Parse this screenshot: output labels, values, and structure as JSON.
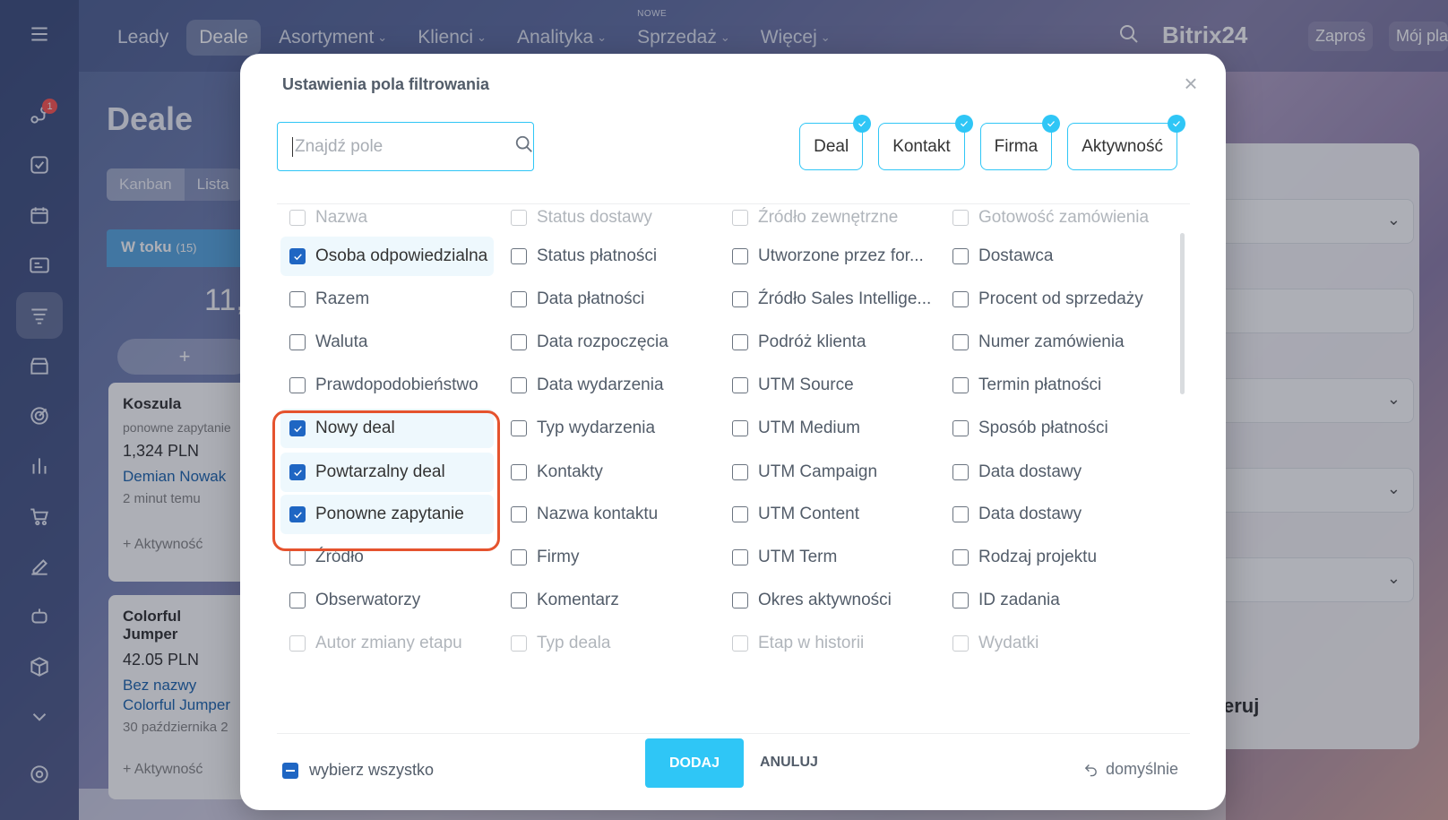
{
  "app": {
    "brand": "Bitrix24",
    "nav": [
      {
        "label": "Leady",
        "active": false,
        "chevron": false,
        "note": ""
      },
      {
        "label": "Deale",
        "active": true,
        "chevron": false,
        "note": ""
      },
      {
        "label": "Asortyment",
        "active": false,
        "chevron": true,
        "note": ""
      },
      {
        "label": "Klienci",
        "active": false,
        "chevron": true,
        "note": ""
      },
      {
        "label": "Analityka",
        "active": false,
        "chevron": true,
        "note": ""
      },
      {
        "label": "Sprzedaż",
        "active": false,
        "chevron": true,
        "note": "NOWE"
      },
      {
        "label": "Więcej",
        "active": false,
        "chevron": true,
        "note": ""
      }
    ],
    "invite_label": "Zaproś",
    "my_plan_label": "Mój pla",
    "rail_badge": "1",
    "page_title": "Deale",
    "views": [
      "Kanban",
      "Lista"
    ],
    "column": {
      "title": "W toku",
      "count": "(15)",
      "sum": "11,"
    },
    "cards": [
      {
        "title": "Koszula",
        "subtitle": "ponowne zapytanie",
        "price": "1,324 PLN",
        "link": "Demian Nowak",
        "time": "2 minut temu",
        "activity": "+ Aktywność"
      },
      {
        "title": "Colorful Jumper",
        "subtitle": "",
        "price": "42.05 PLN",
        "link": "Bez nazwy",
        "link2": "Colorful Jumper",
        "time": "30 października 2",
        "activity": "+ Aktywność"
      }
    ],
    "right_panel_text": "eruj"
  },
  "modal": {
    "title": "Ustawienia pola filtrowania",
    "search_placeholder": "Znajdź pole",
    "search_value": "",
    "type_tags": [
      "Deal",
      "Kontakt",
      "Firma",
      "Aktywność"
    ],
    "columns": [
      [
        {
          "label": "Nazwa",
          "checked": false,
          "faded": true
        },
        {
          "label": "Osoba odpowiedzialna",
          "checked": true,
          "faded": false
        },
        {
          "label": "Razem",
          "checked": false,
          "faded": false
        },
        {
          "label": "Waluta",
          "checked": false,
          "faded": false
        },
        {
          "label": "Prawdopodobieństwo",
          "checked": false,
          "faded": false
        },
        {
          "label": "Nowy deal",
          "checked": true,
          "faded": false
        },
        {
          "label": "Powtarzalny deal",
          "checked": true,
          "faded": false
        },
        {
          "label": "Ponowne zapytanie",
          "checked": true,
          "faded": false
        },
        {
          "label": "Źródło",
          "checked": false,
          "faded": false
        },
        {
          "label": "Obserwatorzy",
          "checked": false,
          "faded": false
        },
        {
          "label": "Autor zmiany etapu",
          "checked": false,
          "faded": true
        }
      ],
      [
        {
          "label": "Status dostawy",
          "checked": false,
          "faded": true
        },
        {
          "label": "Status płatności",
          "checked": false,
          "faded": false
        },
        {
          "label": "Data płatności",
          "checked": false,
          "faded": false
        },
        {
          "label": "Data rozpoczęcia",
          "checked": false,
          "faded": false
        },
        {
          "label": "Data wydarzenia",
          "checked": false,
          "faded": false
        },
        {
          "label": "Typ wydarzenia",
          "checked": false,
          "faded": false
        },
        {
          "label": "Kontakty",
          "checked": false,
          "faded": false
        },
        {
          "label": "Nazwa kontaktu",
          "checked": false,
          "faded": false
        },
        {
          "label": "Firmy",
          "checked": false,
          "faded": false
        },
        {
          "label": "Komentarz",
          "checked": false,
          "faded": false
        },
        {
          "label": "Typ deala",
          "checked": false,
          "faded": true
        }
      ],
      [
        {
          "label": "Źródło zewnętrzne",
          "checked": false,
          "faded": true
        },
        {
          "label": "Utworzone przez for...",
          "checked": false,
          "faded": false
        },
        {
          "label": "Źródło Sales Intellige...",
          "checked": false,
          "faded": false
        },
        {
          "label": "Podróż klienta",
          "checked": false,
          "faded": false
        },
        {
          "label": "UTM Source",
          "checked": false,
          "faded": false
        },
        {
          "label": "UTM Medium",
          "checked": false,
          "faded": false
        },
        {
          "label": "UTM Campaign",
          "checked": false,
          "faded": false
        },
        {
          "label": "UTM Content",
          "checked": false,
          "faded": false
        },
        {
          "label": "UTM Term",
          "checked": false,
          "faded": false
        },
        {
          "label": "Okres aktywności",
          "checked": false,
          "faded": false
        },
        {
          "label": "Etap w historii",
          "checked": false,
          "faded": true
        }
      ],
      [
        {
          "label": "Gotowość zamówienia",
          "checked": false,
          "faded": true
        },
        {
          "label": "Dostawca",
          "checked": false,
          "faded": false
        },
        {
          "label": "Procent od sprzedaży",
          "checked": false,
          "faded": false
        },
        {
          "label": "Numer zamówienia",
          "checked": false,
          "faded": false
        },
        {
          "label": "Termin płatności",
          "checked": false,
          "faded": false
        },
        {
          "label": "Sposób płatności",
          "checked": false,
          "faded": false
        },
        {
          "label": "Data dostawy",
          "checked": false,
          "faded": false
        },
        {
          "label": "Data dostawy",
          "checked": false,
          "faded": false
        },
        {
          "label": "Rodzaj projektu",
          "checked": false,
          "faded": false
        },
        {
          "label": "ID zadania",
          "checked": false,
          "faded": false
        },
        {
          "label": "Wydatki",
          "checked": false,
          "faded": true
        }
      ]
    ],
    "footer": {
      "select_all": "wybierz wszystko",
      "add": "DODAJ",
      "cancel": "ANULUJ",
      "default": "domyślnie"
    }
  },
  "colors": {
    "accent": "#2fc6f6",
    "checkbox": "#1f66c3",
    "highlight": "#e5532e"
  }
}
